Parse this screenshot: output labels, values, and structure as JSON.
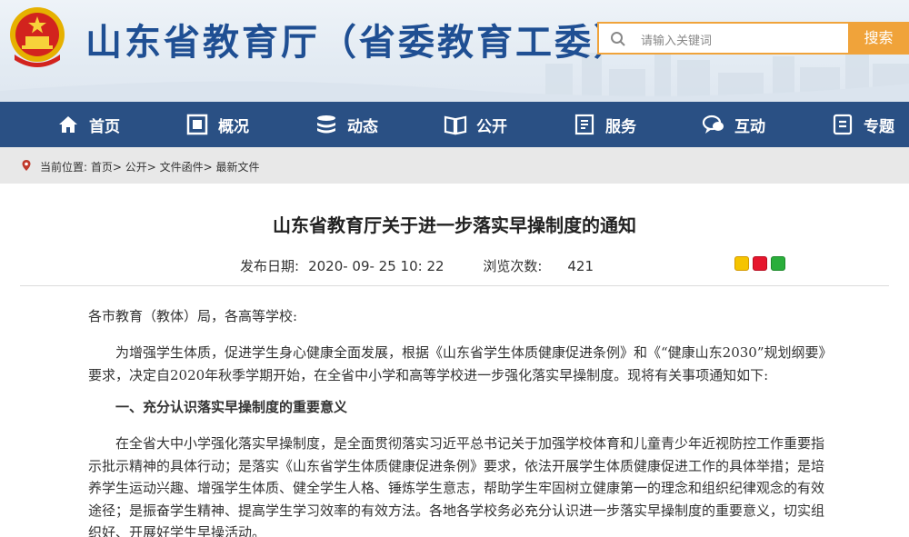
{
  "header": {
    "site_title": "山东省教育厅（省委教育工委）",
    "search_placeholder": "请输入关键词",
    "search_button": "搜索",
    "accent_color": "#f0a33a",
    "title_color": "#1f4f93"
  },
  "nav": {
    "background": "#2a5084",
    "items": [
      {
        "label": "首页",
        "icon": "home-icon"
      },
      {
        "label": "概况",
        "icon": "overview-icon"
      },
      {
        "label": "动态",
        "icon": "news-icon"
      },
      {
        "label": "公开",
        "icon": "book-icon"
      },
      {
        "label": "服务",
        "icon": "service-icon"
      },
      {
        "label": "互动",
        "icon": "chat-icon"
      },
      {
        "label": "专题",
        "icon": "topic-icon"
      }
    ]
  },
  "breadcrumb": {
    "prefix": "当前位置:",
    "items": [
      "首页",
      "公开",
      "文件函件",
      "最新文件"
    ]
  },
  "article": {
    "title": "山东省教育厅关于进一步落实早操制度的通知",
    "publish_label": "发布日期:",
    "publish_date": "2020- 09- 25 10: 22",
    "views_label": "浏览次数:",
    "views": "421",
    "greeting": "各市教育（教体）局，各高等学校:",
    "para1": "为增强学生体质，促进学生身心健康全面发展，根据《山东省学生体质健康促进条例》和《“健康山东2030”规划纲要》要求，决定自2020年秋季学期开始，在全省中小学和高等学校进一步强化落实早操制度。现将有关事项通知如下:",
    "heading1": "一、充分认识落实早操制度的重要意义",
    "para2": "在全省大中小学强化落实早操制度，是全面贯彻落实习近平总书记关于加强学校体育和儿童青少年近视防控工作重要指示批示精神的具体行动；是落实《山东省学生体质健康促进条例》要求，依法开展学生体质健康促进工作的具体举措；是培养学生运动兴趣、增强学生体质、健全学生人格、锤炼学生意志，帮助学生牢固树立健康第一的理念和组织纪律观念的有效途径；是振奋学生精神、提高学生学习效率的有效方法。各地各学校务必充分认识进一步落实早操制度的重要意义，切实组织好、开展好学生早操活动。"
  }
}
